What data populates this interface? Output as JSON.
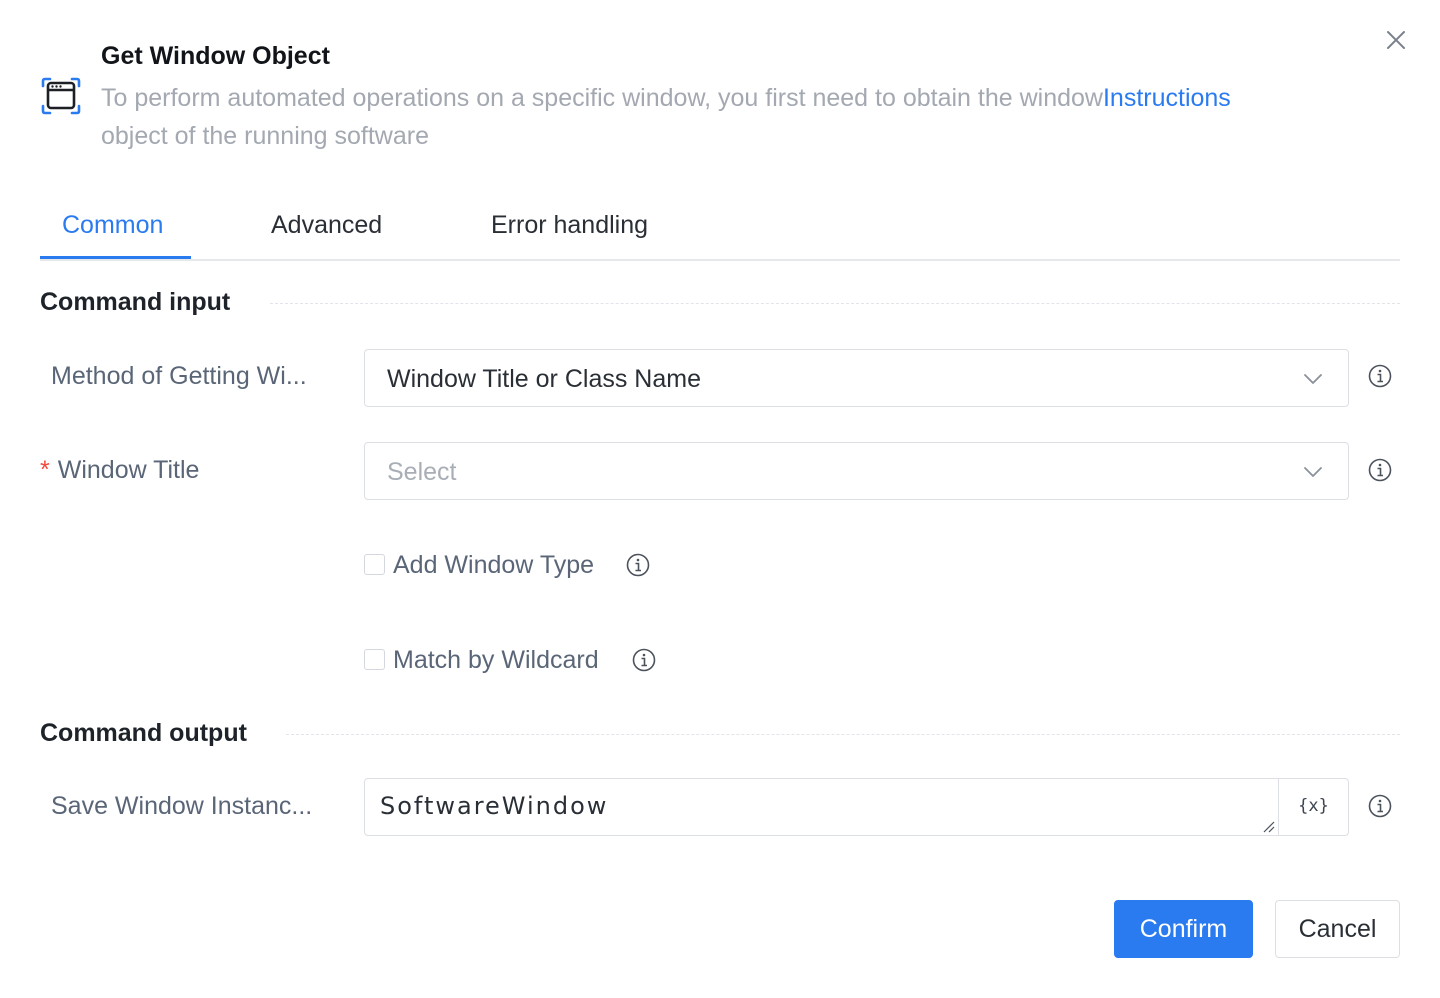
{
  "header": {
    "title": "Get Window Object",
    "description": "To perform automated operations on a specific window, you first need to obtain the window",
    "description_link": "Instructions",
    "description_cont": "object of the running software",
    "icon": "window-icon"
  },
  "tabs": [
    {
      "label": "Common",
      "active": true
    },
    {
      "label": "Advanced",
      "active": false
    },
    {
      "label": "Error handling",
      "active": false
    }
  ],
  "sections": {
    "input_title": "Command input",
    "output_title": "Command output"
  },
  "form": {
    "method": {
      "label": "Method of Getting Wi...",
      "value": "Window Title or Class Name"
    },
    "window_title": {
      "required_mark": "*",
      "label": "Window Title",
      "placeholder": "Select"
    },
    "add_window_type": {
      "label": "Add Window Type",
      "checked": false
    },
    "match_wildcard": {
      "label": "Match by Wildcard",
      "checked": false
    },
    "save_instance": {
      "label": "Save Window Instanc...",
      "value": "SoftwareWindow",
      "variable_button": "{x}"
    }
  },
  "footer": {
    "confirm": "Confirm",
    "cancel": "Cancel"
  },
  "colors": {
    "accent": "#2b7bf0",
    "required": "#f04b3c",
    "muted_text": "#a3a8b1"
  }
}
